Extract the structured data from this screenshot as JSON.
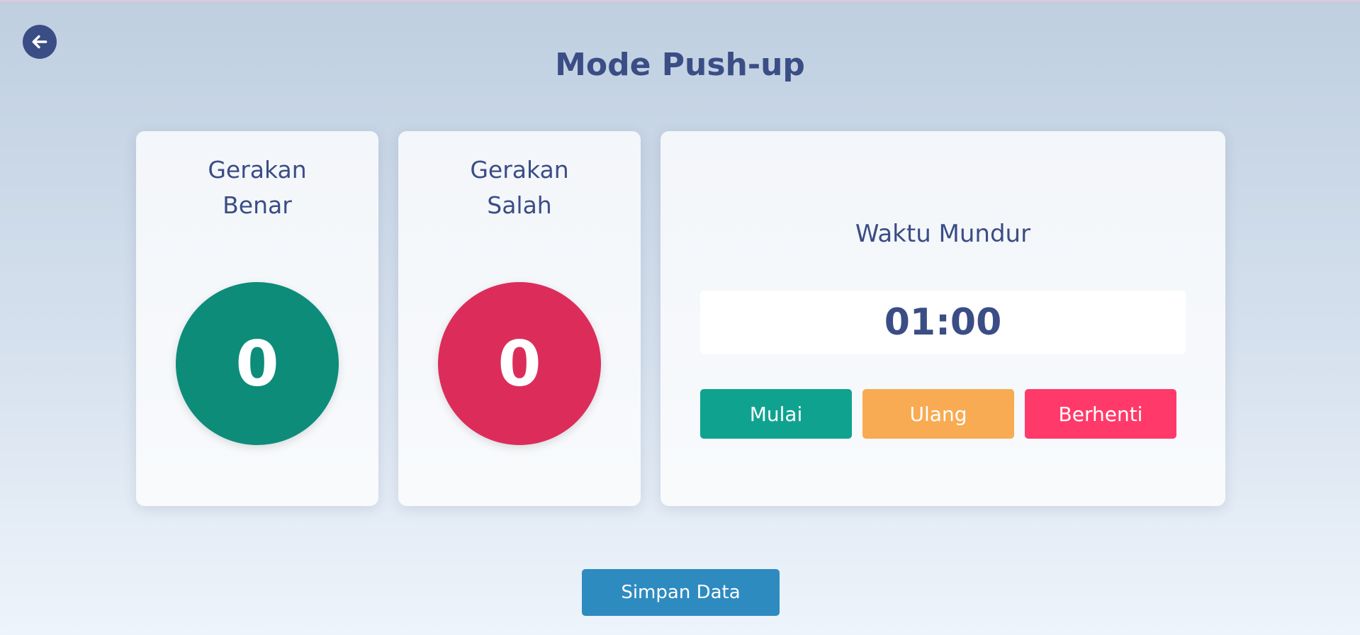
{
  "page": {
    "title": "Mode Push-up"
  },
  "back_button": {
    "icon": "arrow-left-icon"
  },
  "counters": {
    "correct": {
      "label_line1": "Gerakan",
      "label_line2": "Benar",
      "value": "0",
      "color": "#0c8c79"
    },
    "wrong": {
      "label_line1": "Gerakan",
      "label_line2": "Salah",
      "value": "0",
      "color": "#dc2d5a"
    }
  },
  "timer": {
    "label": "Waktu Mundur",
    "value": "01:00",
    "buttons": {
      "start": {
        "label": "Mulai",
        "color": "#0fa38f"
      },
      "reset": {
        "label": "Ulang",
        "color": "#f8ab52"
      },
      "stop": {
        "label": "Berhenti",
        "color": "#ff3a6a"
      }
    }
  },
  "save_button": {
    "label": "Simpan Data",
    "color": "#2e8bc0"
  },
  "colors": {
    "primary_text": "#3b4d85",
    "card_background": "#f5f8fb"
  }
}
